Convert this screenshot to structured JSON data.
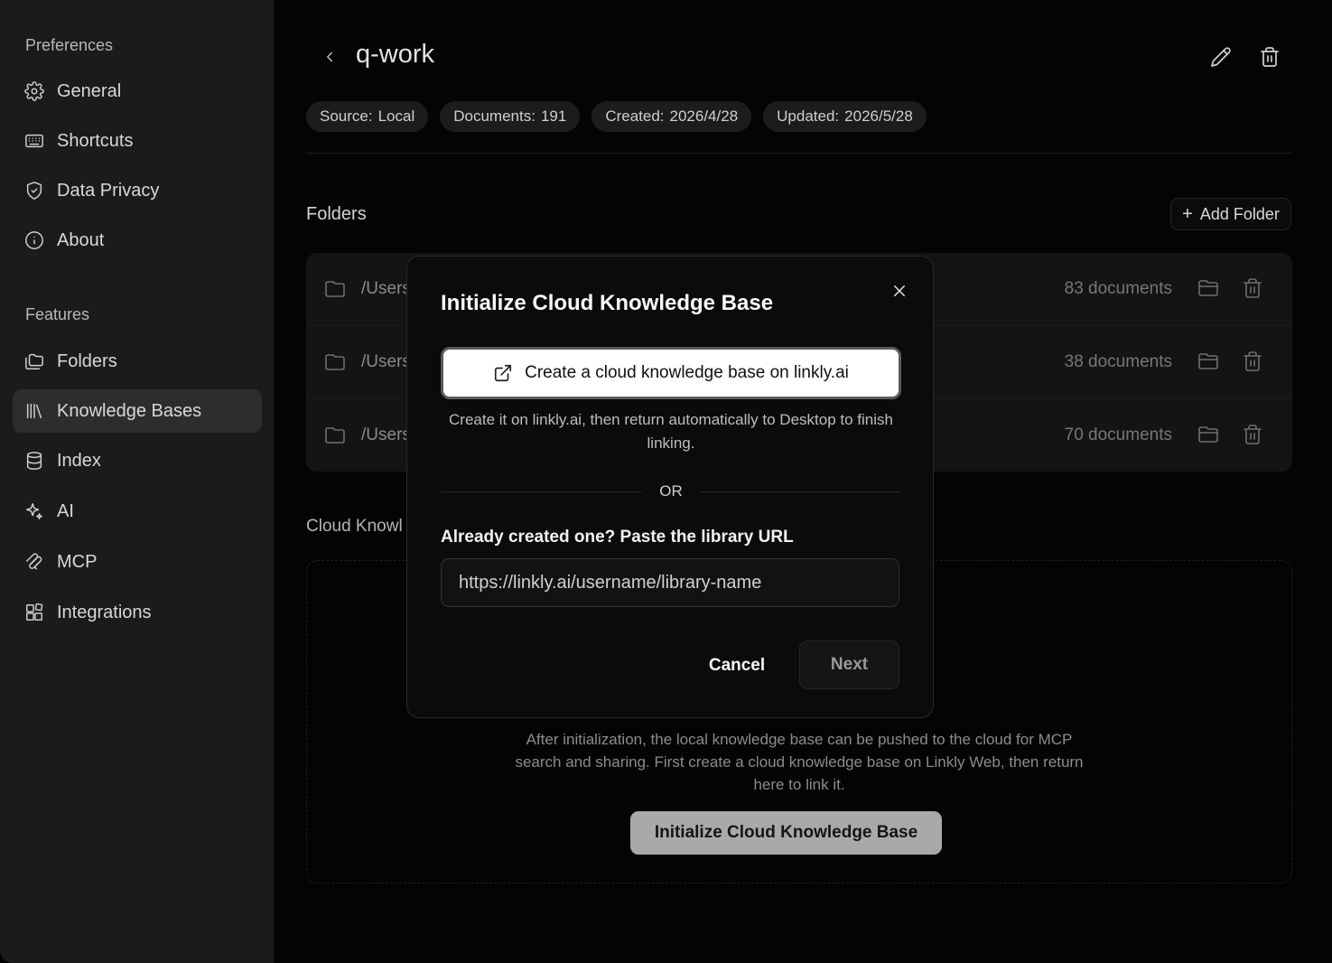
{
  "sidebar": {
    "preferences_label": "Preferences",
    "features_label": "Features",
    "items": [
      {
        "label": "General",
        "icon": "gear-icon"
      },
      {
        "label": "Shortcuts",
        "icon": "keyboard-icon"
      },
      {
        "label": "Data Privacy",
        "icon": "shield-icon"
      },
      {
        "label": "About",
        "icon": "info-icon"
      },
      {
        "label": "Folders",
        "icon": "folders-icon"
      },
      {
        "label": "Knowledge Bases",
        "icon": "library-icon",
        "active": true
      },
      {
        "label": "Index",
        "icon": "database-icon"
      },
      {
        "label": "AI",
        "icon": "sparkles-icon"
      },
      {
        "label": "MCP",
        "icon": "mcp-icon"
      },
      {
        "label": "Integrations",
        "icon": "blocks-icon"
      }
    ]
  },
  "header": {
    "title": "q-work",
    "chips": [
      {
        "key": "Source:",
        "value": "Local"
      },
      {
        "key": "Documents:",
        "value": "191"
      },
      {
        "key": "Created:",
        "value": "2026/4/28"
      },
      {
        "key": "Updated:",
        "value": "2026/5/28"
      }
    ]
  },
  "folders": {
    "heading": "Folders",
    "add_label": "Add Folder",
    "rows": [
      {
        "path": "/Users",
        "count": "83 documents"
      },
      {
        "path": "/Users",
        "count": "38 documents"
      },
      {
        "path": "/Users",
        "count": "70 documents"
      }
    ]
  },
  "cloud": {
    "heading": "Cloud Knowl",
    "description": "After initialization, the local knowledge base can be pushed to the cloud for MCP search and sharing. First create a cloud knowledge base on Linkly Web, then return here to link it.",
    "init_button": "Initialize Cloud Knowledge Base"
  },
  "modal": {
    "title": "Initialize Cloud Knowledge Base",
    "create_button": "Create a cloud knowledge base on linkly.ai",
    "hint": "Create it on linkly.ai, then return automatically to Desktop to finish linking.",
    "or": "OR",
    "url_label": "Already created one? Paste the library URL",
    "url_placeholder": "https://linkly.ai/username/library-name",
    "cancel": "Cancel",
    "next": "Next"
  }
}
